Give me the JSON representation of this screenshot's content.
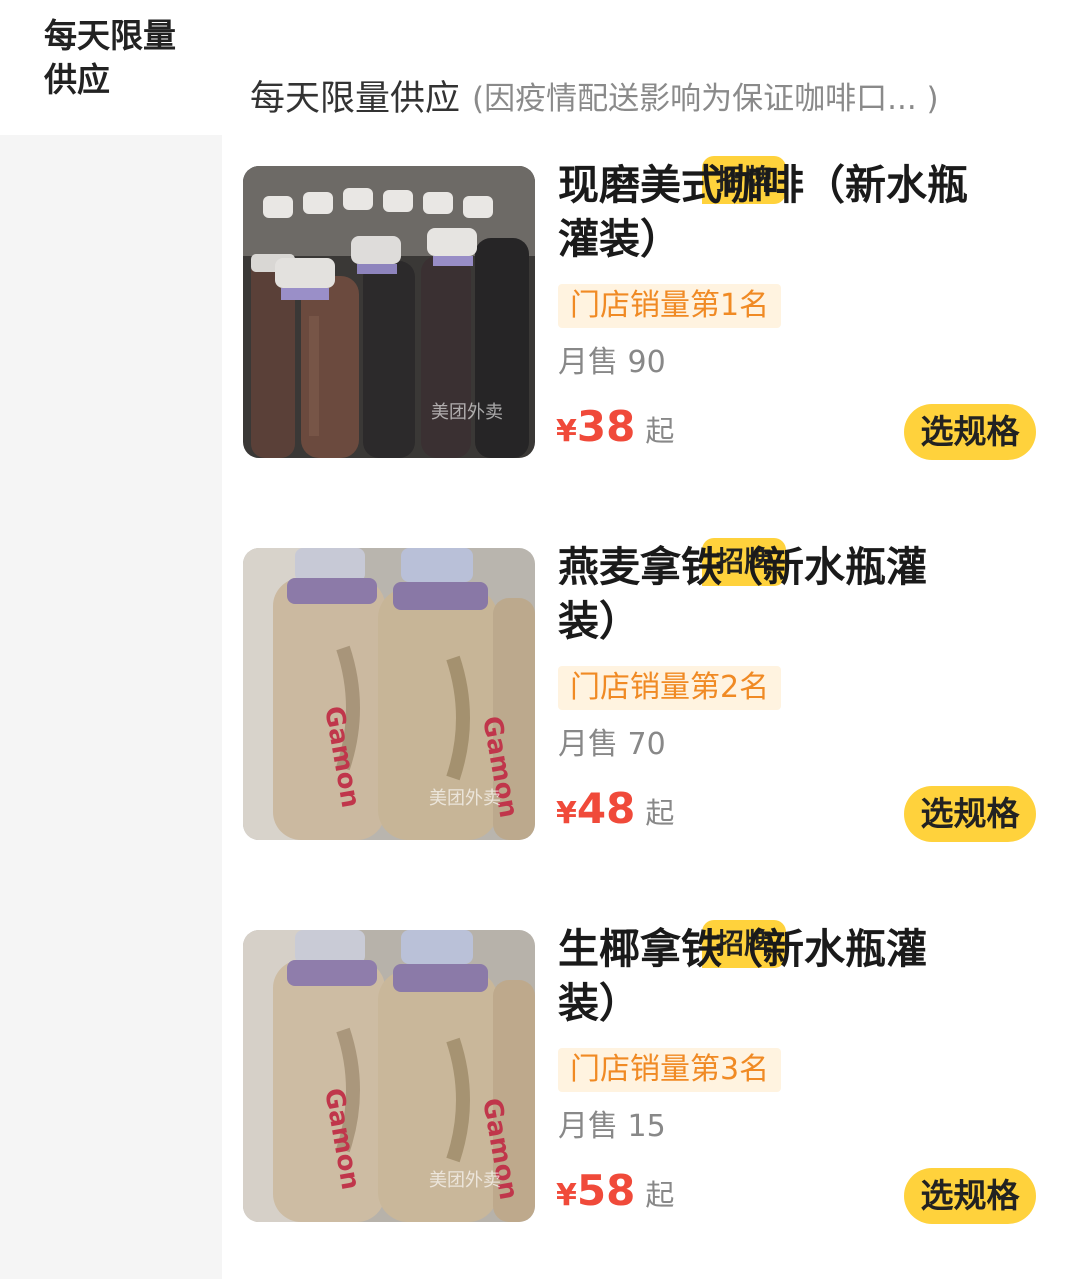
{
  "sidebar": {
    "active_category": "每天限量\n供应"
  },
  "section": {
    "title": "每天限量供应",
    "note": "(因疫情配送影响为保证咖啡口...  )"
  },
  "products": [
    {
      "badge": "招牌",
      "name": "现磨美式咖啡（新水瓶灌装）",
      "rank": "门店销量第1名",
      "monthly_sales": "月售 90",
      "currency": "¥",
      "price": "38",
      "price_suffix": "起",
      "button": "选规格",
      "image": "bottled-americano-photo"
    },
    {
      "badge": "招牌",
      "name": "燕麦拿铁（新水瓶灌装）",
      "rank": "门店销量第2名",
      "monthly_sales": "月售 70",
      "currency": "¥",
      "price": "48",
      "price_suffix": "起",
      "button": "选规格",
      "image": "bottled-oat-latte-photo"
    },
    {
      "badge": "招牌",
      "name": "生椰拿铁（新水瓶灌装）",
      "rank": "门店销量第3名",
      "monthly_sales": "月售 15",
      "currency": "¥",
      "price": "58",
      "price_suffix": "起",
      "button": "选规格",
      "image": "bottled-coconut-latte-photo"
    }
  ],
  "watermark": "美团外卖"
}
